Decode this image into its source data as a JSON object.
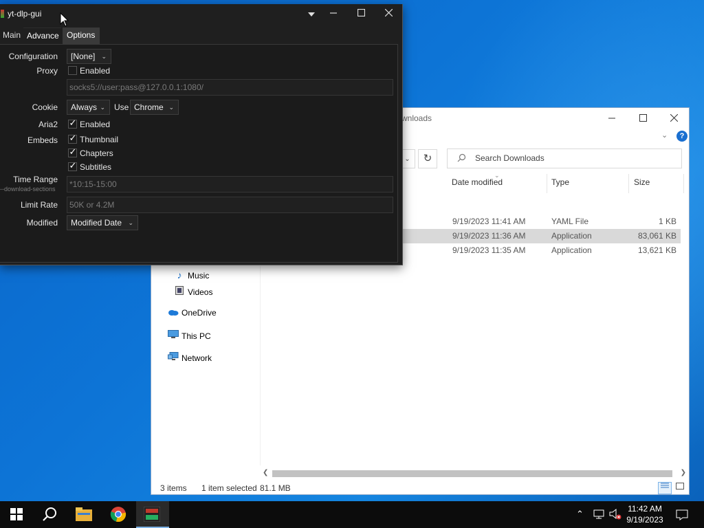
{
  "explorer": {
    "title_fragment": "wnloads",
    "search_placeholder": "Search Downloads",
    "refresh_glyph": "↻",
    "help_glyph": "?",
    "columns": {
      "date": "Date modified",
      "type": "Type",
      "size": "Size"
    },
    "files": [
      {
        "date": "9/19/2023 11:41 AM",
        "type": "YAML File",
        "size": "1 KB",
        "selected": false
      },
      {
        "date": "9/19/2023 11:36 AM",
        "type": "Application",
        "size": "83,061 KB",
        "selected": true
      },
      {
        "date": "9/19/2023 11:35 AM",
        "type": "Application",
        "size": "13,621 KB",
        "selected": false
      }
    ],
    "nav": {
      "music": "Music",
      "videos": "Videos",
      "onedrive": "OneDrive",
      "this_pc": "This PC",
      "network": "Network"
    },
    "status": {
      "items": "3 items",
      "selected": "1 item selected",
      "size": "81.1 MB"
    }
  },
  "ytdlp": {
    "title": "yt-dlp-gui",
    "tabs": {
      "main": "Main",
      "advance": "Advance",
      "options": "Options"
    },
    "labels": {
      "configuration": "Configuration",
      "proxy": "Proxy",
      "cookie": "Cookie",
      "aria2": "Aria2",
      "embeds": "Embeds",
      "time_range": "Time Range",
      "time_range_hint": "--download-sections",
      "limit_rate": "Limit Rate",
      "modified": "Modified",
      "use": "Use"
    },
    "configuration_value": "[None]",
    "proxy_enabled_label": "Enabled",
    "proxy_enabled": false,
    "proxy_placeholder": "socks5://user:pass@127.0.0.1:1080/",
    "cookie_value": "Always",
    "cookie_browser": "Chrome",
    "aria2_label": "Enabled",
    "aria2_enabled": true,
    "embeds": [
      {
        "label": "Thumbnail",
        "checked": true
      },
      {
        "label": "Chapters",
        "checked": true
      },
      {
        "label": "Subtitles",
        "checked": true
      }
    ],
    "time_range_placeholder": "*10:15-15:00",
    "limit_rate_placeholder": "50K or 4.2M",
    "modified_value": "Modified Date"
  },
  "taskbar": {
    "clock_time": "11:42 AM",
    "clock_date": "9/19/2023",
    "apps": [
      "start-icon",
      "search-icon",
      "file-explorer-icon",
      "chrome-icon",
      "yt-dlp-gui-icon"
    ]
  },
  "colors": {
    "desktop": "#0d74d6",
    "yt_bg": "#1f1f1f",
    "explorer_selected": "#d9d9d9",
    "accent": "#1a6fd0"
  }
}
